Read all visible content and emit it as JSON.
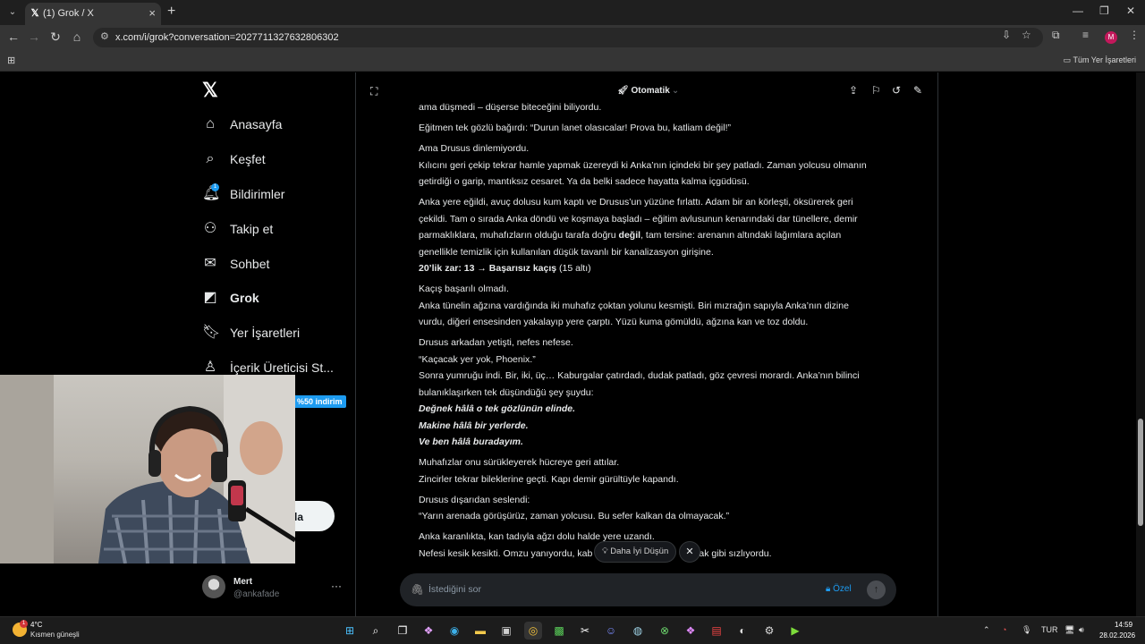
{
  "browser": {
    "tab_title": "(1) Grok / X",
    "url": "x.com/i/grok?conversation=2027711327632806302",
    "bookmarks_folder": "Tüm Yer İşaretleri",
    "profile_initial": "M",
    "profile_color": "#c2185b"
  },
  "sidebar": {
    "logo": "X",
    "items": [
      {
        "label": "Anasayfa",
        "icon": "home-icon"
      },
      {
        "label": "Keşfet",
        "icon": "search-icon"
      },
      {
        "label": "Bildirimler",
        "icon": "bell-icon",
        "badge": "1"
      },
      {
        "label": "Takip et",
        "icon": "follow-icon"
      },
      {
        "label": "Sohbet",
        "icon": "mail-icon"
      },
      {
        "label": "Grok",
        "icon": "grok-icon",
        "active": true
      },
      {
        "label": "Yer İşaretleri",
        "icon": "bookmark-icon"
      },
      {
        "label": "İçerik Üreticisi St...",
        "icon": "creator-studio-icon"
      }
    ],
    "promo_badge": "%50 indirim",
    "post_button_partial": "la",
    "account": {
      "name": "Mert",
      "handle": "@ankafade"
    }
  },
  "grok": {
    "model": "Otomatik",
    "paragraphs": [
      [
        "ama düşmedi – düşerse biteceğini biliyordu."
      ],
      [
        "Eğitmen tek gözlü bağırdı: “Durun lanet olasıcalar! Prova bu, katliam değil!”"
      ],
      [
        "Ama Drusus dinlemiyordu.",
        "Kılıcını geri çekip tekrar hamle yapmak üzereydi ki Anka’nın içindeki bir şey patladı. Zaman yolcusu olmanın",
        "getirdiği o garip, mantıksız cesaret. Ya da belki sadece hayatta kalma içgüdüsü."
      ],
      [
        "Anka yere eğildi, avuç dolusu kum kaptı ve Drusus’un yüzüne fırlattı. Adam bir an körleşti, öksürerek geri",
        "çekildi. Tam o sırada Anka döndü ve koşmaya başladı – eğitim avlusunun kenarındaki dar tünellere, demir"
      ],
      [
        "Kaçış başarılı olmadı.",
        "Anka tünelin ağzına vardığında iki muhafız çoktan yolunu kesmişti. Biri mızrağın sapıyla Anka’nın dizine",
        "vurdu, diğeri ensesinden yakalayıp yere çarptı. Yüzü kuma gömüldü, ağzına kan ve toz doldu."
      ],
      [
        "Drusus arkadan yetişti, nefes nefese.",
        "“Kaçacak yer yok, Phoenix.”",
        "Sonra yumruğu indi. Bir, iki, üç… Kaburgalar çatırdadı, dudak patladı, göz çevresi morardı. Anka’nın bilinci",
        "bulanıklaşırken tek düşündüğü şey şuydu:"
      ],
      [
        "Muhafızlar onu sürükleyerek hücreye geri attılar.",
        "Zincirler tekrar bileklerine geçti. Kapı demir gürültüyle kapandı."
      ],
      [
        "Drusus dışarıdan seslendi:",
        "“Yarın arenada görüşürüz, zaman yolcusu. Bu sefer kalkan da olmayacak.”"
      ],
      [
        "Anka karanlıkta, kan tadıyla ağzı dolu halde yere uzandı.",
        "Nefesi kesik kesikti. Omzu yanıyordu, kab",
        "acak gibi sızlıyordu."
      ]
    ],
    "p4_line3_pre": "parmaklıklara, muhafızların olduğu tarafa doğru ",
    "p4_line3_bold": "değil",
    "p4_line3_post": ", tam tersine: arenanın altındaki lağımlara açılan",
    "p4_line4": "genellikle temizlik için kullanılan düşük tavanlı bir kanalizasyon girişine.",
    "dice_bold": "20’lik zar: 13 → Başarısız kaçış",
    "dice_rest": " (15 altı)",
    "italic_lines": [
      "Değnek hâlâ o tek gözlünün elinde.",
      "Makine hâlâ bir yerlerde.",
      "Ve ben hâlâ buradayım."
    ],
    "think_pill": "Daha İyi Düşün",
    "input_placeholder": "İstediğini sor",
    "private_label": "Özel"
  },
  "taskbar": {
    "temperature": "4°C",
    "weather": "Kısmen güneşli",
    "language": "TUR",
    "time": "14:59",
    "date": "28.02.2026",
    "weather_badge": "1"
  }
}
